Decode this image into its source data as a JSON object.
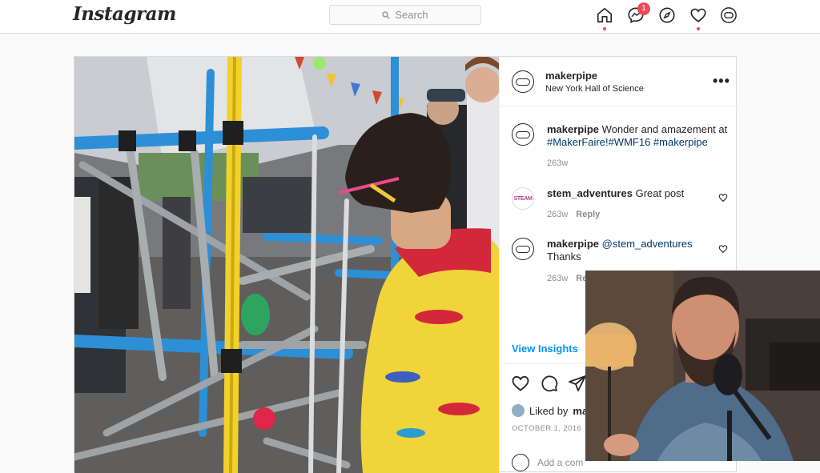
{
  "header": {
    "logo": "Instagram",
    "search_placeholder": "Search",
    "messages_badge": "1"
  },
  "post": {
    "author": "makerpipe",
    "location": "New York Hall of Science",
    "caption": {
      "username": "makerpipe",
      "text": "Wonder and amazement at",
      "hashtags": "#MakerFaire!#WMF16 #makerpipe",
      "time": "263w"
    },
    "comments": [
      {
        "username": "stem_adventures",
        "avatar_text": "STEAM",
        "text": "Great post",
        "time": "263w",
        "reply": "Reply"
      },
      {
        "username": "makerpipe",
        "mention": "@stem_adventures",
        "text": "Thanks",
        "time": "263w",
        "reply": "Re"
      }
    ],
    "view_insights": "View Insights",
    "liked_by": "Liked by",
    "liked_by_name": "ma",
    "date": "OCTOBER 1, 2016",
    "add_comment": "Add a com"
  },
  "colors": {
    "accent_blue": "#0095f6",
    "notification_red": "#ed4956",
    "link_blue": "#00376b"
  }
}
